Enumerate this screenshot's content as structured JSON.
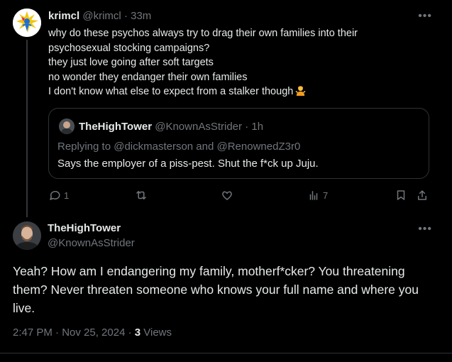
{
  "parent_tweet": {
    "name": "krimcl",
    "handle": "@krimcl",
    "separator": "·",
    "time": "33m",
    "lines": [
      "why do these psychos always try to drag their own families into their",
      "psychosexual stocking campaigns?",
      "they just love going after soft targets",
      "no wonder they endanger their own families",
      "I don't know what else to expect from a stalker though"
    ],
    "emoji": "person-shrugging-emoji",
    "more_icon": "ellipsis-icon"
  },
  "quoted_tweet": {
    "name": "TheHighTower",
    "handle": "@KnownAsStrider",
    "separator": "·",
    "time": "1h",
    "replying_to": "Replying to @dickmasterson and @RenownedZ3r0",
    "text": "Says the employer of a piss-pest. Shut the f*ck up Juju."
  },
  "actions": {
    "reply_count": "1",
    "views_count": "7",
    "icons": [
      "reply-icon",
      "retweet-icon",
      "like-icon",
      "views-icon",
      "bookmark-icon",
      "share-icon"
    ]
  },
  "main_tweet": {
    "name": "TheHighTower",
    "handle": "@KnownAsStrider",
    "text": "Yeah? How am I endangering my family, motherf*cker? You threatening them? Never threaten someone who knows your full name and where you live.",
    "timestamp": "2:47 PM · Nov 25, 2024 · ",
    "views_count": "3",
    "views_label": " Views"
  },
  "colors": {
    "background": "#000000",
    "text_primary": "#e7e9ea",
    "text_secondary": "#71767b",
    "border": "#2f3336"
  }
}
